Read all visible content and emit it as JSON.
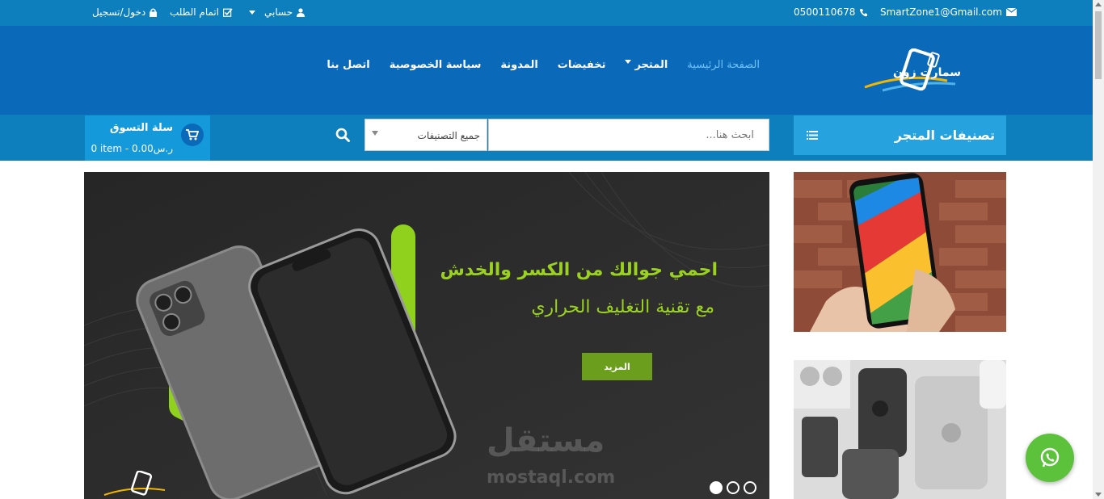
{
  "topbar": {
    "email": "SmartZone1@Gmail.com",
    "phone": "0500110678",
    "login": "دخول/تسجيل",
    "checkout": "اتمام الطلب",
    "account": "حسابي"
  },
  "nav": {
    "items": [
      {
        "label": "الصفحة الرئيسية"
      },
      {
        "label": "المتجر"
      },
      {
        "label": "تخفيضات"
      },
      {
        "label": "المدونة"
      },
      {
        "label": "سياسة الخصوصية"
      },
      {
        "label": "اتصل بنا"
      }
    ]
  },
  "logo": {
    "text": "سمارت زون"
  },
  "categories": {
    "title": "تصنيفات المتجر"
  },
  "search": {
    "placeholder": "ابحث هنا...",
    "category_selected": "جميع التصنيفات"
  },
  "cart": {
    "title": "سلة التسوق",
    "summary": "0 item - 0.00ر.س"
  },
  "slider": {
    "headline": "احمي جوالك من الكسر والخدش",
    "subheadline": "مع تقنية التغليف الحراري",
    "button": "المزيد",
    "watermark_ar": "مستقل",
    "watermark_en": "mostaql.com",
    "slide_count": 3,
    "active_slide": 1
  },
  "colors": {
    "topbar": "#0d7fbc",
    "header": "#0a69b9",
    "categories_bg": "#26a3df",
    "accent_green": "#9bd21f",
    "whatsapp": "#5cc23b"
  }
}
